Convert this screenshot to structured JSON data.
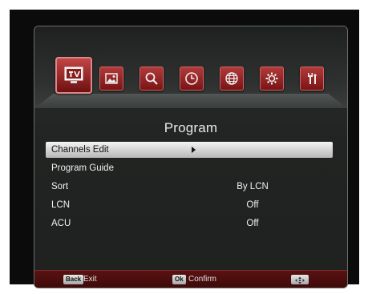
{
  "page": {
    "title": "Program"
  },
  "main_menu": {
    "icons": [
      {
        "name": "tv-icon",
        "active": true
      },
      {
        "name": "picture-icon",
        "active": false
      },
      {
        "name": "search-icon",
        "active": false
      },
      {
        "name": "clock-icon",
        "active": false
      },
      {
        "name": "globe-icon",
        "active": false
      },
      {
        "name": "gear-icon",
        "active": false
      },
      {
        "name": "tools-icon",
        "active": false
      }
    ]
  },
  "rows": [
    {
      "label": "Channels Edit",
      "value": "",
      "selected": true
    },
    {
      "label": "Program Guide",
      "value": "",
      "selected": false
    },
    {
      "label": "Sort",
      "value": "By LCN",
      "selected": false
    },
    {
      "label": "LCN",
      "value": "Off",
      "selected": false
    },
    {
      "label": "ACU",
      "value": "Off",
      "selected": false
    }
  ],
  "footer": {
    "back_key": "Back",
    "back_label": "Exit",
    "ok_key": "Ok",
    "ok_label": "Confirm",
    "nav_icon": "dpad-icon"
  },
  "colors": {
    "accent": "#8a1c1c",
    "footer": "#4a0d0d",
    "selection": "#d6d6d6"
  }
}
